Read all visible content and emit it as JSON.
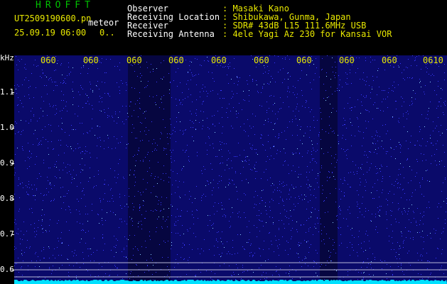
{
  "header": {
    "program": "HROFFT",
    "filename": "UT2509190600.pn",
    "meteor_label": "meteor",
    "datetime": "25.09.19 06:00",
    "count": "0..",
    "fields": [
      {
        "label": "Observer",
        "value": ": Masaki Kano"
      },
      {
        "label": "Receiving Location",
        "value": ": Shibukawa, Gunma, Japan"
      },
      {
        "label": "Receiver",
        "value": ": SDR# 43dB L15 111.6MHz USB"
      },
      {
        "label": "Receiving Antenna",
        "value": ": 4ele Yagi Az 230 for Kansai VOR"
      }
    ]
  },
  "spectrogram": {
    "y_unit": "kHz",
    "y_ticks": [
      "1.1",
      "1.0",
      "0.9",
      "0.8",
      "0.7",
      "0.6"
    ],
    "x_ticks": [
      "060",
      "060",
      "060",
      "060",
      "060",
      "060",
      "060",
      "060",
      "060",
      "0610"
    ],
    "colors": {
      "background": "#0a0a6a",
      "noise": "#3a3aff",
      "baseline": "#00e0ff",
      "tick_text": "#e8e800"
    }
  }
}
